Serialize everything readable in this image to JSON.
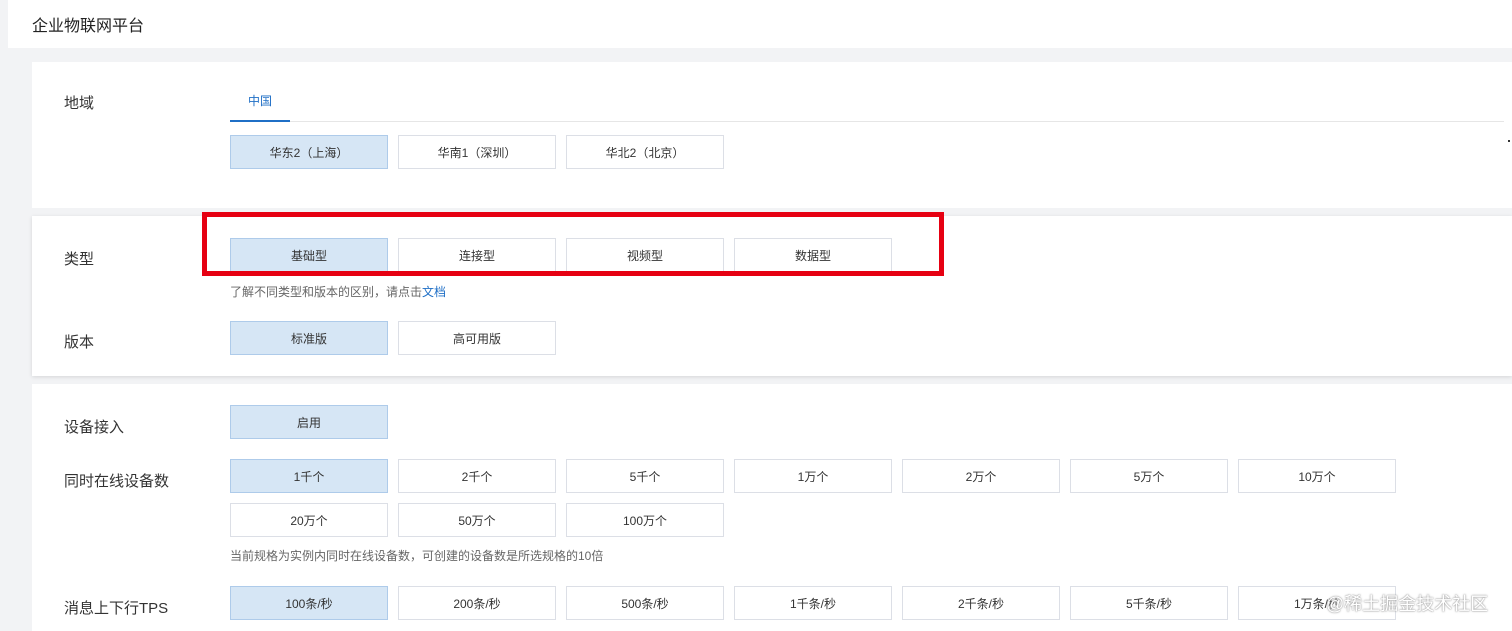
{
  "header": {
    "title": "企业物联网平台"
  },
  "region": {
    "label": "地域",
    "tab": "中国",
    "options": [
      "华东2（上海）",
      "华南1（深圳）",
      "华北2（北京）"
    ]
  },
  "type": {
    "label": "类型",
    "options": [
      "基础型",
      "连接型",
      "视频型",
      "数据型"
    ],
    "hint": "了解不同类型和版本的区别，请点击",
    "hint_link": "文档"
  },
  "version": {
    "label": "版本",
    "options": [
      "标准版",
      "高可用版"
    ]
  },
  "device_access": {
    "label": "设备接入",
    "options": [
      "启用"
    ]
  },
  "online_devices": {
    "label": "同时在线设备数",
    "options": [
      "1千个",
      "2千个",
      "5千个",
      "1万个",
      "2万个",
      "5万个",
      "10万个",
      "20万个",
      "50万个",
      "100万个"
    ],
    "hint": "当前规格为实例内同时在线设备数，可创建的设备数是所选规格的10倍"
  },
  "tps": {
    "label": "消息上下行TPS",
    "options": [
      "100条/秒",
      "200条/秒",
      "500条/秒",
      "1千条/秒",
      "2千条/秒",
      "5千条/秒",
      "1万条/秒"
    ]
  },
  "watermark": "@稀土掘金技术社区"
}
